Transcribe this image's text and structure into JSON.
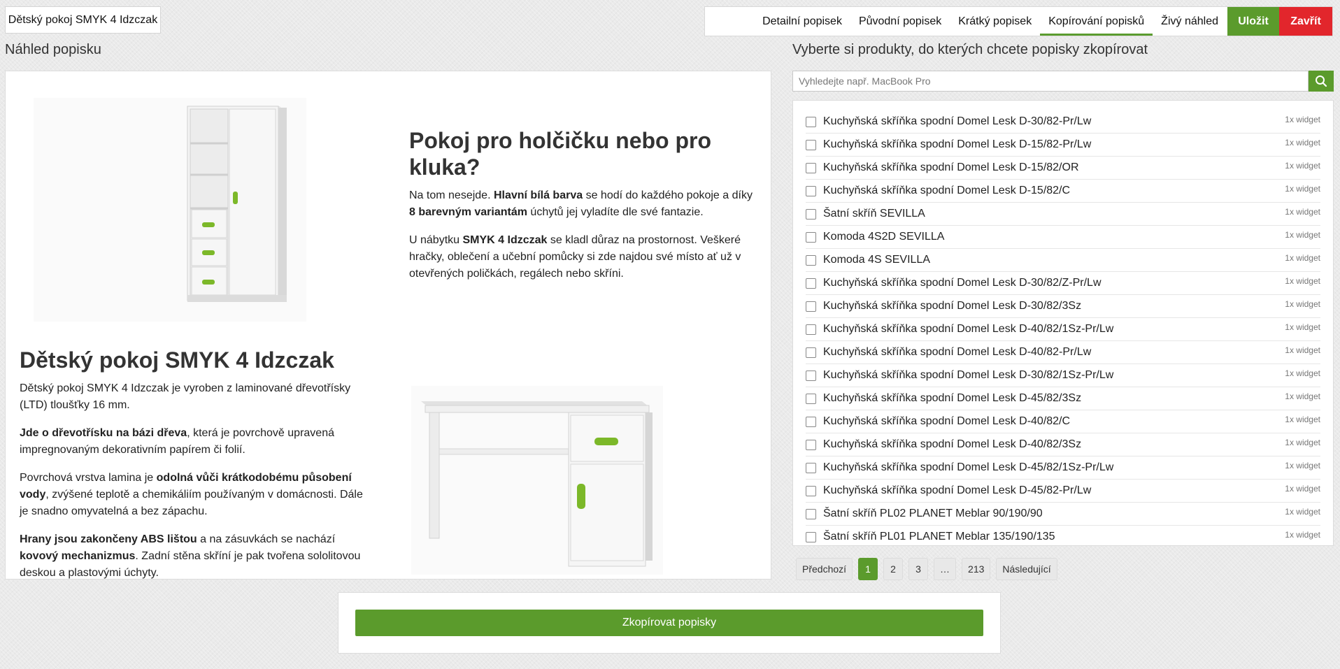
{
  "header": {
    "product_title": "Dětský pokoj SMYK 4 Idzczak",
    "tabs": [
      {
        "label": "Detailní popisek",
        "active": false
      },
      {
        "label": "Původní popisek",
        "active": false
      },
      {
        "label": "Krátký popisek",
        "active": false
      },
      {
        "label": "Kopírování popisků",
        "active": true
      },
      {
        "label": "Živý náhled",
        "active": false
      }
    ],
    "save_label": "Uložit",
    "close_label": "Zavřít",
    "accent_color": "#5b9b2c",
    "danger_color": "#e2262c"
  },
  "preview": {
    "heading": "Náhled popisku",
    "block1": {
      "title": "Pokoj pro holčičku nebo pro kluka?",
      "p1": [
        {
          "t": "Na tom nesejde. ",
          "b": false
        },
        {
          "t": "Hlavní bílá barva",
          "b": true
        },
        {
          "t": " se hodí do každého pokoje a díky ",
          "b": false
        },
        {
          "t": "8 barevným variantám",
          "b": true
        },
        {
          "t": " úchytů jej vyladíte dle své fantazie.",
          "b": false
        }
      ],
      "p2": [
        {
          "t": "U nábytku ",
          "b": false
        },
        {
          "t": "SMYK 4 Idzczak",
          "b": true
        },
        {
          "t": " se kladl důraz na prostornost. Veškeré hračky, oblečení a učební pomůcky si zde najdou své místo ať už v otevřených poličkách, regálech nebo skříni.",
          "b": false
        }
      ]
    },
    "block2": {
      "title": "Dětský pokoj SMYK 4 Idzczak",
      "p1": [
        {
          "t": "Dětský pokoj SMYK 4 Idzczak je vyroben z laminované dřevotřísky (LTD) tloušťky 16 mm.",
          "b": false
        }
      ],
      "p2": [
        {
          "t": "Jde o dřevotřísku na bázi dřeva",
          "b": true
        },
        {
          "t": ", která je povrchově upravená impregnovaným dekorativním papírem či folií.",
          "b": false
        }
      ],
      "p3": [
        {
          "t": "Povrchová vrstva lamina je ",
          "b": false
        },
        {
          "t": "odolná vůči krátkodobému působení vody",
          "b": true
        },
        {
          "t": ", zvýšené teplotě a chemikáliím používaným v domácnosti. Dále je snadno omyvatelná a bez zápachu.",
          "b": false
        }
      ],
      "p4": [
        {
          "t": "Hrany jsou zakončeny ABS lištou",
          "b": true
        },
        {
          "t": " a na zásuvkách se nachází ",
          "b": false
        },
        {
          "t": "kovový mechanizmus",
          "b": true
        },
        {
          "t": ". Zadní stěna skříní je pak tvořena sololitovou deskou a plastovými úchyty.",
          "b": false
        }
      ]
    }
  },
  "products": {
    "heading": "Vyberte si produkty, do kterých chcete popisky zkopírovat",
    "search_placeholder": "Vyhledejte např. MacBook Pro",
    "items": [
      {
        "name": "Kuchyňská skříňka spodní Domel Lesk D-30/82-Pr/Lw",
        "badge": "1x widget"
      },
      {
        "name": "Kuchyňská skříňka spodní Domel Lesk D-15/82-Pr/Lw",
        "badge": "1x widget"
      },
      {
        "name": "Kuchyňská skříňka spodní Domel Lesk D-15/82/OR",
        "badge": "1x widget"
      },
      {
        "name": "Kuchyňská skříňka spodní Domel Lesk D-15/82/C",
        "badge": "1x widget"
      },
      {
        "name": "Šatní skříň SEVILLA",
        "badge": "1x widget"
      },
      {
        "name": "Komoda 4S2D SEVILLA",
        "badge": "1x widget"
      },
      {
        "name": "Komoda 4S SEVILLA",
        "badge": "1x widget"
      },
      {
        "name": "Kuchyňská skříňka spodní Domel Lesk D-30/82/Z-Pr/Lw",
        "badge": "1x widget"
      },
      {
        "name": "Kuchyňská skříňka spodní Domel Lesk D-30/82/3Sz",
        "badge": "1x widget"
      },
      {
        "name": "Kuchyňská skříňka spodní Domel Lesk D-40/82/1Sz-Pr/Lw",
        "badge": "1x widget"
      },
      {
        "name": "Kuchyňská skříňka spodní Domel Lesk D-40/82-Pr/Lw",
        "badge": "1x widget"
      },
      {
        "name": "Kuchyňská skříňka spodní Domel Lesk D-30/82/1Sz-Pr/Lw",
        "badge": "1x widget"
      },
      {
        "name": "Kuchyňská skříňka spodní Domel Lesk D-45/82/3Sz",
        "badge": "1x widget"
      },
      {
        "name": "Kuchyňská skříňka spodní Domel Lesk D-40/82/C",
        "badge": "1x widget"
      },
      {
        "name": "Kuchyňská skříňka spodní Domel Lesk D-40/82/3Sz",
        "badge": "1x widget"
      },
      {
        "name": "Kuchyňská skříňka spodní Domel Lesk D-45/82/1Sz-Pr/Lw",
        "badge": "1x widget"
      },
      {
        "name": "Kuchyňská skříňka spodní Domel Lesk D-45/82-Pr/Lw",
        "badge": "1x widget"
      },
      {
        "name": "Šatní skříň PL02 PLANET Meblar 90/190/90",
        "badge": "1x widget"
      },
      {
        "name": "Šatní skříň PL01 PLANET Meblar 135/190/135",
        "badge": "1x widget"
      }
    ],
    "search_icon": "search-icon"
  },
  "pagination": {
    "prev_label": "Předchozí",
    "pages": [
      "1",
      "2",
      "3",
      "…",
      "213"
    ],
    "current": "1",
    "next_label": "Následující"
  },
  "footer": {
    "copy_label": "Zkopírovat popisky"
  }
}
